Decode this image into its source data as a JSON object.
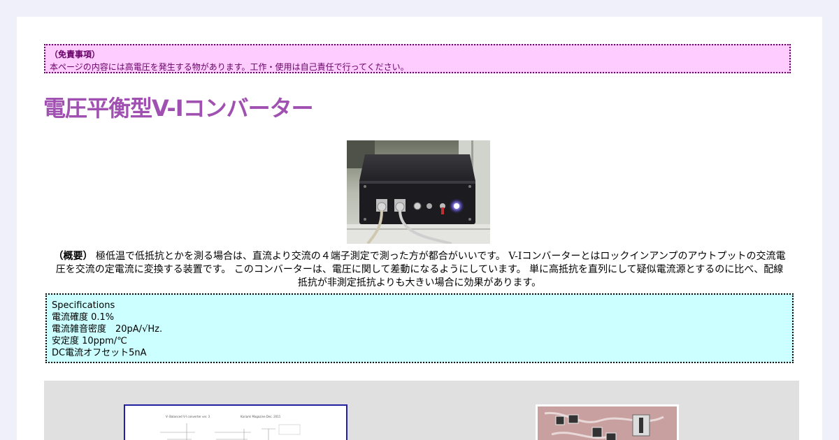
{
  "disclaimer": {
    "title": "（免責事項）",
    "body": "本ページの内容には高電圧を発生する物があります。工作・使用は自己責任で行ってください。"
  },
  "title": "電圧平衡型V-Iコンバーター",
  "overview": {
    "label": "（概要）",
    "text": "極低温で低抵抗とかを測る場合は、直流より交流の４端子測定で測った方が都合がいいです。 V-Iコンバーターとはロックインアンプのアウトプットの交流電圧を交流の定電流に変換する装置です。 このコンバーターは、電圧に関して差動になるようにしています。 単に高抵抗を直列にして疑似電流源とするのに比べ、配線抵抗が非測定抵抗よりも大きい場合に効果があります。"
  },
  "specs": {
    "heading": "Specifications",
    "items": [
      "電流確度 0.1%",
      "電流雑音密度　20pA/√Hz.",
      "安定度 10ppm/℃",
      "DC電流オフセット5nA"
    ]
  },
  "schematic": {
    "caption_left": "V- Balanced V-I converter  ver. 3",
    "caption_right": "Kariami Magazine Dec. 2011"
  },
  "colors": {
    "page_bg": "#f0f0fa",
    "disclaimer_bg": "#ffccff",
    "disclaimer_text": "#660066",
    "title": "#a050b0",
    "specs_bg": "#ccffff",
    "gallery_bg": "#e0e0e0",
    "schematic_border": "#2020a0",
    "pcb": "#c8a0a0"
  }
}
